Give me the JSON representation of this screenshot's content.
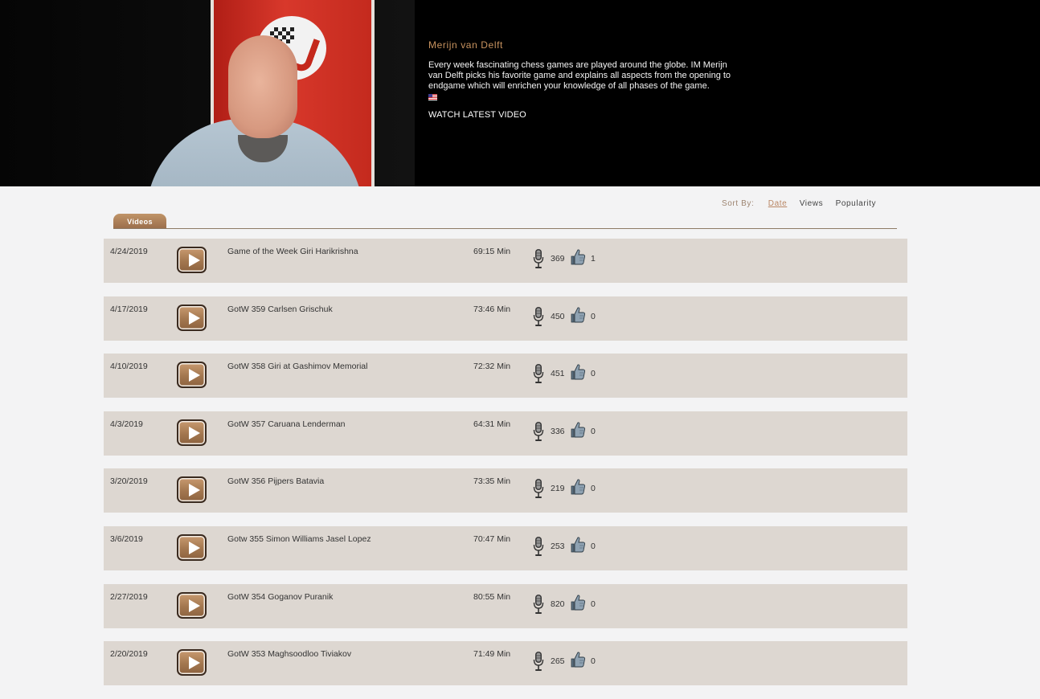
{
  "hero": {
    "name": "Merijn van Delft",
    "description": "Every week fascinating chess games are played around the globe. IM Merijn van Delft picks his favorite game and explains all aspects from the opening to endgame which will enrichen your knowledge of all phases of the game.",
    "watch_label": "WATCH LATEST VIDEO",
    "flag_icon": "us-flag-icon"
  },
  "sort": {
    "label": "Sort By:",
    "options": [
      "Date",
      "Views",
      "Popularity"
    ],
    "active": "Date"
  },
  "tabs": {
    "videos_label": "Videos"
  },
  "colors": {
    "accent": "#c8935f",
    "row_bg": "#ddd7d1",
    "tab_bg": "#a87b55"
  },
  "icons": {
    "play": "play-icon",
    "views": "microphone-icon",
    "likes": "thumbs-up-icon"
  },
  "videos": [
    {
      "date": "4/24/2019",
      "title": "Game of the Week Giri Harikrishna",
      "length": "69:15 Min",
      "views": "369",
      "likes": "1"
    },
    {
      "date": "4/17/2019",
      "title": "GotW 359 Carlsen Grischuk",
      "length": "73:46 Min",
      "views": "450",
      "likes": "0"
    },
    {
      "date": "4/10/2019",
      "title": "GotW 358 Giri at Gashimov Memorial",
      "length": "72:32 Min",
      "views": "451",
      "likes": "0"
    },
    {
      "date": "4/3/2019",
      "title": "GotW 357 Caruana Lenderman",
      "length": "64:31 Min",
      "views": "336",
      "likes": "0"
    },
    {
      "date": "3/20/2019",
      "title": "GotW 356 Pijpers Batavia",
      "length": "73:35 Min",
      "views": "219",
      "likes": "0"
    },
    {
      "date": "3/6/2019",
      "title": "Gotw 355 Simon Williams Jasel Lopez",
      "length": "70:47 Min",
      "views": "253",
      "likes": "0"
    },
    {
      "date": "2/27/2019",
      "title": "GotW 354 Goganov Puranik",
      "length": "80:55 Min",
      "views": "820",
      "likes": "0"
    },
    {
      "date": "2/20/2019",
      "title": "GotW 353 Maghsoodloo Tiviakov",
      "length": "71:49 Min",
      "views": "265",
      "likes": "0"
    }
  ]
}
